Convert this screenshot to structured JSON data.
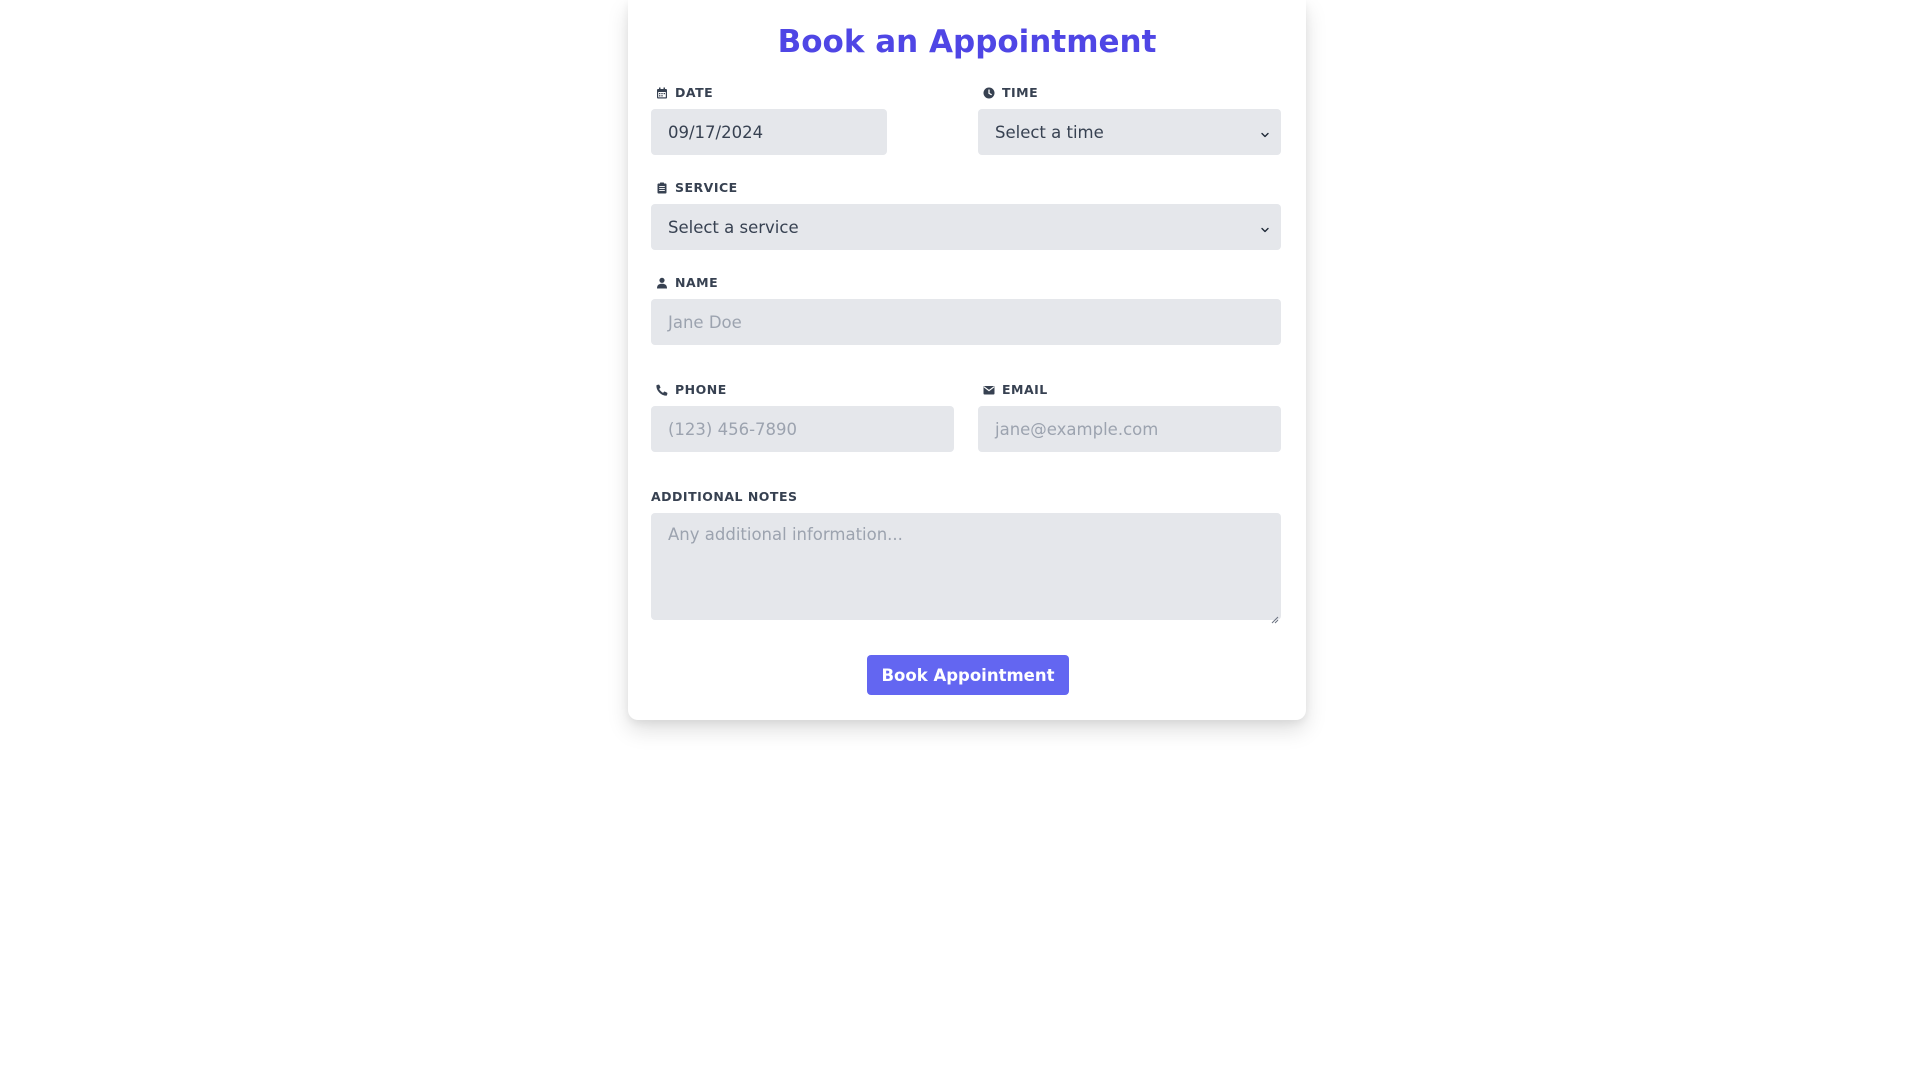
{
  "form": {
    "title": "Book an Appointment",
    "date": {
      "label": "DATE",
      "value": "09/17/2024",
      "icon": "calendar-icon"
    },
    "time": {
      "label": "TIME",
      "selected": "Select a time",
      "icon": "clock-icon"
    },
    "service": {
      "label": "SERVICE",
      "selected": "Select a service",
      "icon": "clipboard-icon"
    },
    "name": {
      "label": "NAME",
      "placeholder": "Jane Doe",
      "icon": "user-icon"
    },
    "phone": {
      "label": "PHONE",
      "placeholder": "(123) 456-7890",
      "icon": "phone-icon"
    },
    "email": {
      "label": "EMAIL",
      "placeholder": "jane@example.com",
      "icon": "envelope-icon"
    },
    "notes": {
      "label": "ADDITIONAL NOTES",
      "placeholder": "Any additional information..."
    },
    "submit_label": "Book Appointment"
  },
  "colors": {
    "accent": "#4f46e5",
    "button": "#6366f1",
    "field_bg": "#e5e7eb",
    "label_text": "#374151",
    "placeholder_text": "#9ca3af"
  }
}
